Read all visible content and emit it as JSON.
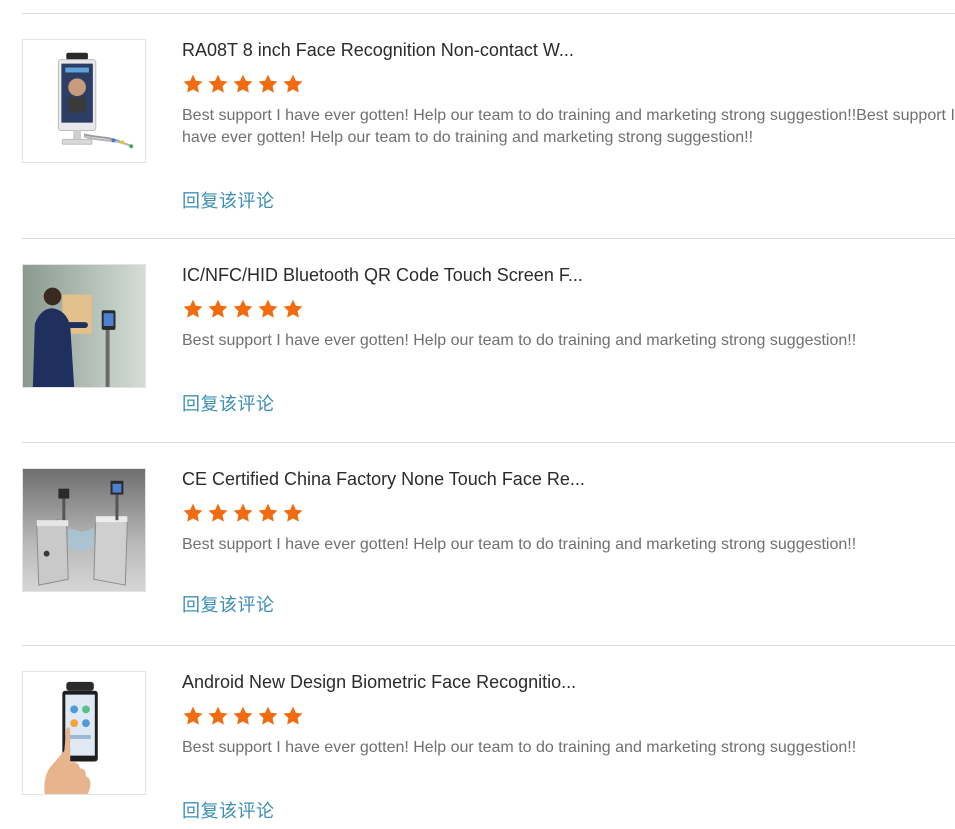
{
  "reviews": [
    {
      "title": "RA08T 8 inch Face Recognition Non-contact W...",
      "rating": 5,
      "comment": "Best support I have ever gotten! Help our team to do training and marketing strong suggestion!!Best support I have ever gotten! Help our team to do training and marketing strong suggestion!!",
      "reply_label": "回复该评论"
    },
    {
      "title": "IC/NFC/HID Bluetooth QR Code Touch Screen F...",
      "rating": 5,
      "comment": "Best support I have ever gotten! Help our team to do training and marketing strong suggestion!!",
      "reply_label": "回复该评论"
    },
    {
      "title": "CE Certified China Factory None Touch Face Re...",
      "rating": 5,
      "comment": "Best support I have ever gotten! Help our team to do training and marketing strong suggestion!!",
      "reply_label": "回复该评论"
    },
    {
      "title": "Android New Design Biometric Face Recognitio...",
      "rating": 5,
      "comment": "Best support I have ever gotten! Help our team to do training and marketing strong suggestion!!",
      "reply_label": "回复该评论"
    }
  ],
  "colors": {
    "star": "#f26b0f",
    "reply_link": "#3b8fb5",
    "title_text": "#2b2b2b",
    "comment_text": "#707070",
    "divider": "#d9d9d9"
  }
}
